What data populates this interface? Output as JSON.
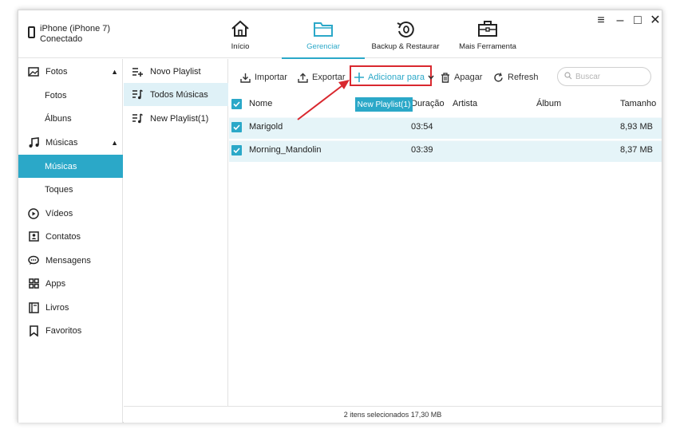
{
  "device": {
    "name": "iPhone (iPhone 7)",
    "status": "Conectado"
  },
  "nav": {
    "tabs": [
      {
        "label": "Início",
        "icon": "home-icon"
      },
      {
        "label": "Gerenciar",
        "icon": "folder-icon"
      },
      {
        "label": "Backup & Restaurar",
        "icon": "backup-icon"
      },
      {
        "label": "Mais Ferramenta",
        "icon": "toolbox-icon"
      }
    ],
    "active": "Gerenciar"
  },
  "window_controls": {
    "menu": "≡",
    "minimize": "–",
    "maximize": "□",
    "close": "✕"
  },
  "sidebar": {
    "items": [
      {
        "label": "Fotos",
        "icon": "photo-icon"
      },
      {
        "label": "Fotos"
      },
      {
        "label": "Álbuns"
      },
      {
        "label": "Músicas",
        "icon": "music-icon"
      },
      {
        "label": "Músicas"
      },
      {
        "label": "Toques"
      },
      {
        "label": "Vídeos",
        "icon": "video-icon"
      },
      {
        "label": "Contatos",
        "icon": "contacts-icon"
      },
      {
        "label": "Mensagens",
        "icon": "message-icon"
      },
      {
        "label": "Apps",
        "icon": "apps-icon"
      },
      {
        "label": "Livros",
        "icon": "book-icon"
      },
      {
        "label": "Favoritos",
        "icon": "bookmark-icon"
      }
    ],
    "selected": "Músicas"
  },
  "playlists": {
    "items": [
      {
        "label": "Novo Playlist",
        "icon": "add-playlist-icon"
      },
      {
        "label": "Todos Músicas",
        "icon": "playlist-icon"
      },
      {
        "label": "New Playlist(1)",
        "icon": "playlist-icon"
      }
    ],
    "selected": "Todos Músicas"
  },
  "toolbar": {
    "import": "Importar",
    "export": "Exportar",
    "add_to": "Adicionar para",
    "delete": "Apagar",
    "refresh": "Refresh",
    "search_placeholder": "Buscar"
  },
  "dropdown": {
    "option": "New Playlist(1)"
  },
  "table": {
    "columns": [
      "Nome",
      "Duração",
      "Artista",
      "Álbum",
      "Tamanho"
    ],
    "rows": [
      {
        "name": "Marigold",
        "duration": "03:54",
        "artist": "",
        "album": "",
        "size": "8,93 MB",
        "checked": true
      },
      {
        "name": "Morning_Mandolin",
        "duration": "03:39",
        "artist": "",
        "album": "",
        "size": "8,37 MB",
        "checked": true
      }
    ]
  },
  "status_bar": "2 itens selecionados 17,30 MB",
  "colors": {
    "accent": "#2ba8c8",
    "highlight": "#d9282f",
    "row_bg": "#e5f4f8"
  }
}
